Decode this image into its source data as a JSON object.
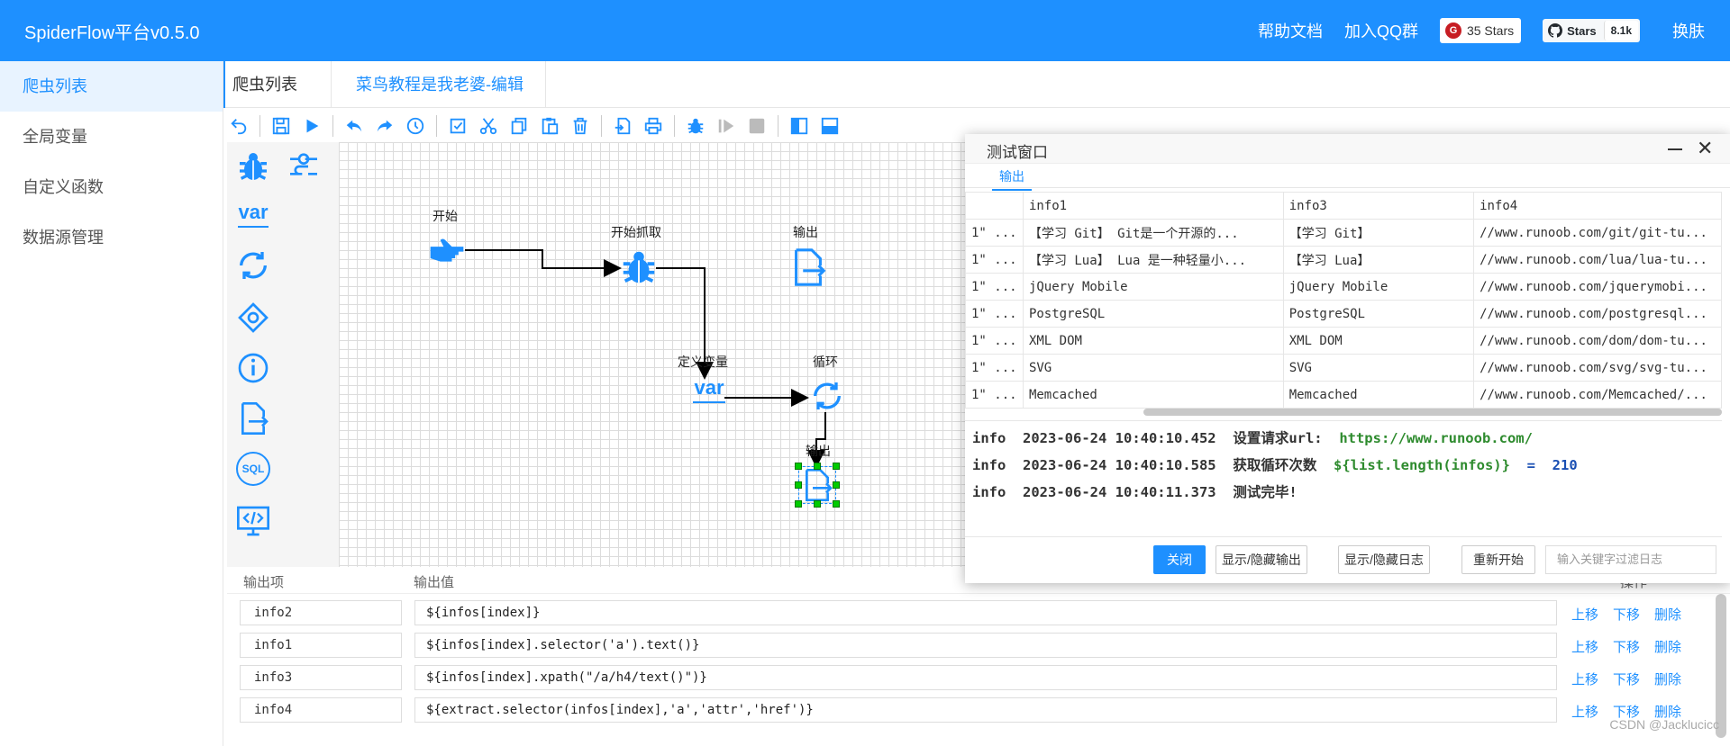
{
  "app": {
    "title": "SpiderFlow平台v0.5.0"
  },
  "topnav": {
    "help": "帮助文档",
    "qq": "加入QQ群",
    "gitee_icon": "G",
    "gitee_stars": "35 Stars",
    "github_label": "Stars",
    "github_count": "8.1k",
    "skin": "换肤"
  },
  "sidebar": {
    "items": [
      {
        "label": "爬虫列表"
      },
      {
        "label": "全局变量"
      },
      {
        "label": "自定义函数"
      },
      {
        "label": "数据源管理"
      }
    ]
  },
  "tabs": {
    "list": "爬虫列表",
    "edit": "菜鸟教程是我老婆-编辑"
  },
  "canvas": {
    "nodes": {
      "start": "开始",
      "crawl": "开始抓取",
      "output1": "输出",
      "var": "定义变量",
      "loop": "循环",
      "output2": "输出"
    }
  },
  "palette_text": {
    "var": "var",
    "sql": "SQL"
  },
  "bottom": {
    "headers": {
      "key": "输出项",
      "value": "输出值",
      "ops": "操作"
    },
    "rows": [
      {
        "key": "info2",
        "value": "${infos[index]}"
      },
      {
        "key": "info1",
        "value": "${infos[index].selector('a').text()}"
      },
      {
        "key": "info3",
        "value": "${infos[index].xpath(\"/a/h4/text()\")}"
      },
      {
        "key": "info4",
        "value": "${extract.selector(infos[index],'a','attr','href')}"
      }
    ],
    "actions": {
      "up": "上移",
      "down": "下移",
      "del": "删除"
    }
  },
  "dialog": {
    "title": "测试窗口",
    "tab": "输出",
    "columns": [
      "",
      "info1",
      "info3",
      "info4"
    ],
    "rows": [
      [
        "1\" ...",
        "【学习 Git】 Git是一个开源的...",
        "【学习 Git】",
        "//www.runoob.com/git/git-tu..."
      ],
      [
        "1\" ...",
        "【学习 Lua】 Lua 是一种轻量小...",
        "【学习 Lua】",
        "//www.runoob.com/lua/lua-tu..."
      ],
      [
        "1\" ...",
        "jQuery Mobile",
        "jQuery Mobile",
        "//www.runoob.com/jquerymobi..."
      ],
      [
        "1\" ...",
        "PostgreSQL",
        "PostgreSQL",
        "//www.runoob.com/postgresql..."
      ],
      [
        "1\" ...",
        "XML DOM",
        "XML DOM",
        "//www.runoob.com/dom/dom-tu..."
      ],
      [
        "1\" ...",
        "SVG",
        "SVG",
        "//www.runoob.com/svg/svg-tu..."
      ],
      [
        "1\" ...",
        "Memcached",
        "Memcached",
        "//www.runoob.com/Memcached/..."
      ]
    ],
    "logs": [
      {
        "level": "info",
        "time": "2023-06-24 10:40:10.452",
        "msg": "设置请求url:",
        "arg": "https://www.runoob.com/",
        "eq": "",
        "num": ""
      },
      {
        "level": "info",
        "time": "2023-06-24 10:40:10.585",
        "msg": "获取循环次数",
        "arg": "${list.length(infos)}",
        "eq": "=",
        "num": "210"
      },
      {
        "level": "info",
        "time": "2023-06-24 10:40:11.373",
        "msg": "测试完毕!",
        "arg": "",
        "eq": "",
        "num": ""
      }
    ],
    "buttons": {
      "close": "关闭",
      "toggle_output": "显示/隐藏输出",
      "toggle_log": "显示/隐藏日志",
      "restart": "重新开始"
    },
    "filter_placeholder": "输入关键字过滤日志"
  },
  "watermark": "CSDN @Jacklucicc",
  "colors": {
    "accent": "#1e90ff",
    "log_green": "#2e8b2e",
    "log_blue": "#1a4fb3"
  }
}
